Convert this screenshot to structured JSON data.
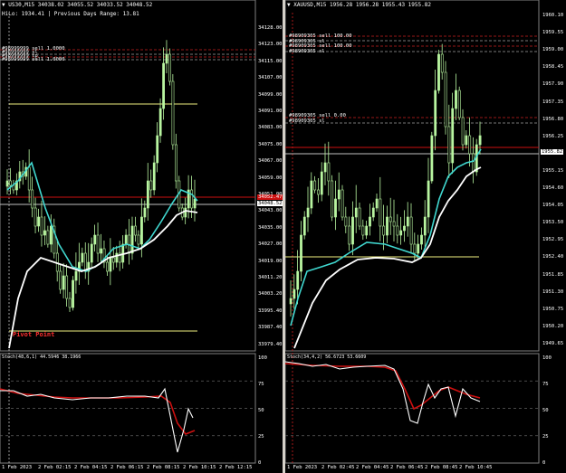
{
  "left": {
    "header_line1": "US30,M15  34038.02 34055.52 34033.52 34048.52",
    "header_line2": "HiLo: 1934.41 | Previous Days Range: 13.81",
    "price_labels": [
      "34128.00",
      "34123.00",
      "34115.00",
      "34107.00",
      "34099.00",
      "34091.00",
      "34083.00",
      "34075.00",
      "34067.00",
      "34059.00",
      "34051.00",
      "34043.00",
      "34035.00",
      "34027.00",
      "34019.00",
      "34011.20",
      "34003.20",
      "33995.40",
      "33987.40",
      "33979.40"
    ],
    "price_tag_current": "34048.52",
    "price_tag_red": "34052.47",
    "order_lines": [
      "#98999999 sell 1.0000",
      "#98999999 sl",
      "#98999999 tp",
      "#98999999 sell 1.0000"
    ],
    "pivot_label": "Pivot Point",
    "stoch_label": "Stoch(48,6,1) 44.5946 38.1966",
    "stoch_levels": [
      "100",
      "75",
      "50",
      "25",
      "0"
    ],
    "time_labels": [
      "1 Feb 2023",
      "2 Feb 02:15",
      "2 Feb 04:15",
      "2 Feb 06:15",
      "2 Feb 08:15",
      "2 Feb 10:15",
      "2 Feb 12:15"
    ]
  },
  "right": {
    "header_line1": "XAUUSD,M15  1956.28 1956.28 1955.43 1955.82",
    "price_labels": [
      "1960.10",
      "1959.55",
      "1959.00",
      "1958.45",
      "1957.90",
      "1957.35",
      "1956.80",
      "1956.25",
      "1955.70",
      "1955.15",
      "1954.60",
      "1954.05",
      "1953.50",
      "1952.95",
      "1952.40",
      "1951.85",
      "1951.30",
      "1950.75",
      "1950.20",
      "1949.65"
    ],
    "price_tag_current": "1955.82",
    "order_lines": [
      "#98909305 sell 100.00",
      "#98909305 sl",
      "#98909305 sell 100.00",
      "#98909305 sl",
      "#98909305 sell 0.00",
      "#98909305 sl"
    ],
    "stoch_label": "Stoch(34,4,2) 56.6723 53.6609",
    "stoch_levels": [
      "100",
      "75",
      "50",
      "25",
      "0"
    ],
    "time_labels": [
      "1 Feb 2023",
      "2 Feb 02:45",
      "2 Feb 04:45",
      "2 Feb 06:45",
      "2 Feb 08:45",
      "2 Feb 10:45"
    ]
  },
  "colors": {
    "background": "#000000",
    "candle": "#b8f5a0",
    "ma_fast": "#40d8d0",
    "ma_slow": "#ffffff",
    "stoch_main": "#ffffff",
    "stoch_signal": "#cc1010",
    "range_line": "#f0f080",
    "order_line": "#cc2020",
    "grid": "#606060"
  }
}
